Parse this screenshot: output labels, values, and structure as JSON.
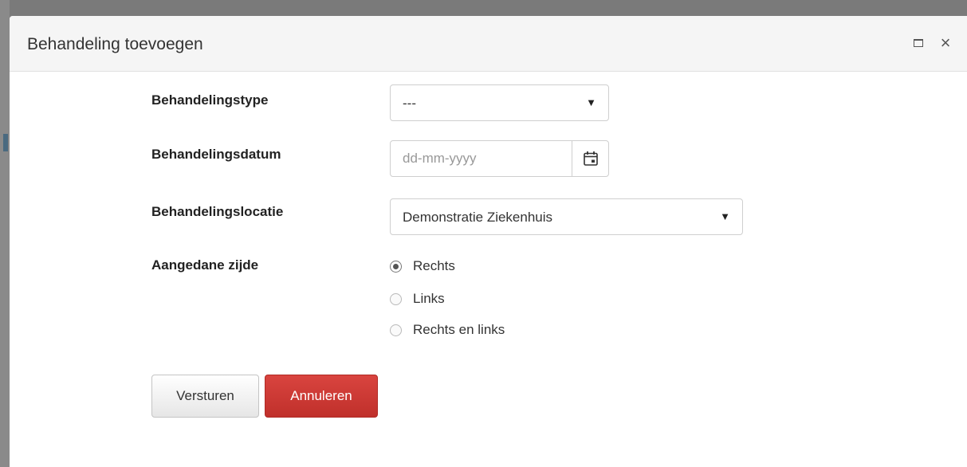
{
  "dialog": {
    "title": "Behandeling toevoegen"
  },
  "form": {
    "type": {
      "label": "Behandelingstype",
      "value": "---"
    },
    "date": {
      "label": "Behandelingsdatum",
      "placeholder": "dd-mm-yyyy",
      "value": ""
    },
    "location": {
      "label": "Behandelingslocatie",
      "value": "Demonstratie Ziekenhuis"
    },
    "side": {
      "label": "Aangedane zijde",
      "options": [
        {
          "label": "Rechts",
          "checked": true
        },
        {
          "label": "Links",
          "checked": false
        },
        {
          "label": "Rechts en links",
          "checked": false
        }
      ]
    }
  },
  "buttons": {
    "submit_label": "Versturen",
    "cancel_label": "Annuleren"
  },
  "icons": {
    "maximize": "maximize-icon",
    "close": "close-icon",
    "select_caret": "caret-down-icon",
    "calendar": "calendar-icon"
  },
  "colors": {
    "cancel_button": "#c9302c",
    "titlebar": "#f5f5f5",
    "backdrop": "#7a7a7a"
  }
}
